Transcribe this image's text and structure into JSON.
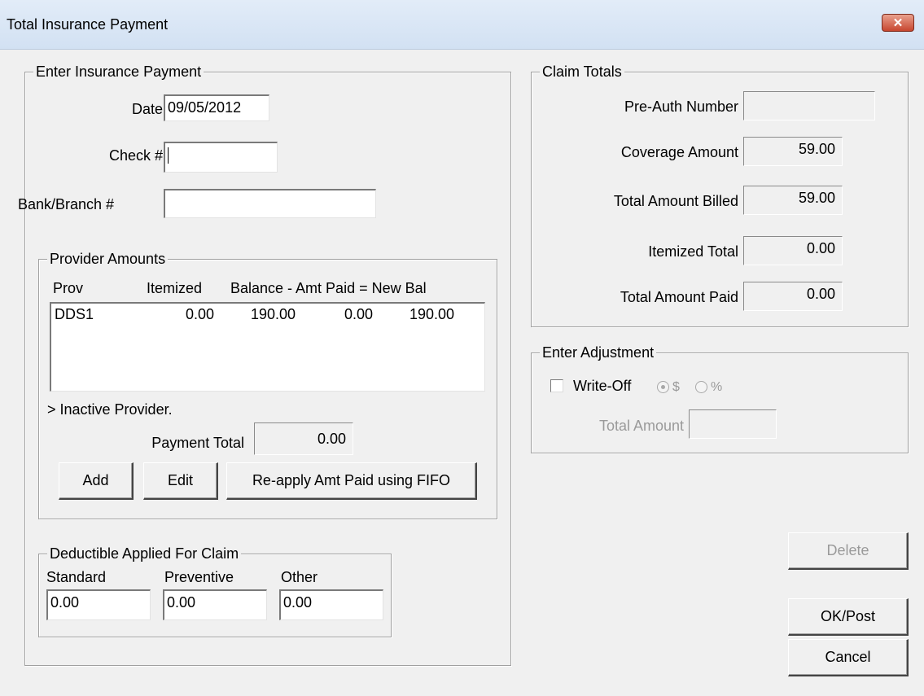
{
  "window": {
    "title": "Total Insurance Payment",
    "close_glyph": "✕"
  },
  "enter_payment": {
    "legend": "Enter Insurance Payment",
    "date_label": "Date",
    "date_value": "09/05/2012",
    "check_label": "Check #",
    "check_value": "",
    "bank_label": "Bank/Branch #",
    "bank_value": ""
  },
  "provider_amounts": {
    "legend": "Provider Amounts",
    "columns": {
      "prov": "Prov",
      "itemized": "Itemized",
      "balance_header": "Balance - Amt Paid = New Bal"
    },
    "rows": [
      {
        "prov": "DDS1",
        "itemized": "0.00",
        "balance": "190.00",
        "amt_paid": "0.00",
        "new_bal": "190.00"
      }
    ],
    "inactive_note": "> Inactive Provider.",
    "payment_total_label": "Payment Total",
    "payment_total_value": "0.00",
    "add_label": "Add",
    "edit_label": "Edit",
    "reapply_label": "Re-apply Amt Paid using FIFO"
  },
  "deductible": {
    "legend": "Deductible Applied For Claim",
    "standard_label": "Standard",
    "standard_value": "0.00",
    "preventive_label": "Preventive",
    "preventive_value": "0.00",
    "other_label": "Other",
    "other_value": "0.00"
  },
  "claim_totals": {
    "legend": "Claim Totals",
    "preauth_label": "Pre-Auth Number",
    "preauth_value": "",
    "coverage_label": "Coverage Amount",
    "coverage_value": "59.00",
    "billed_label": "Total Amount Billed",
    "billed_value": "59.00",
    "itemized_label": "Itemized Total",
    "itemized_value": "0.00",
    "paid_label": "Total Amount Paid",
    "paid_value": "0.00"
  },
  "adjustment": {
    "legend": "Enter Adjustment",
    "writeoff_label": "Write-Off",
    "writeoff_checked": false,
    "dollar_label": "$",
    "percent_label": "%",
    "selected_mode": "$",
    "total_amount_label": "Total Amount",
    "total_amount_value": ""
  },
  "buttons": {
    "delete": "Delete",
    "ok_post": "OK/Post",
    "cancel": "Cancel"
  },
  "colors": {
    "titlebar": "#d8e5f5",
    "close": "#c7462f",
    "dialog_bg": "#f0f0f0"
  }
}
